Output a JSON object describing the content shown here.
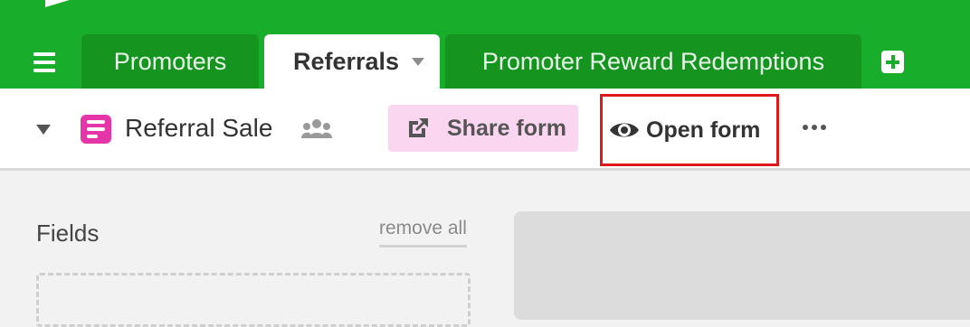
{
  "tabs": [
    {
      "label": "Promoters"
    },
    {
      "label": "Referrals"
    },
    {
      "label": "Promoter Reward Redemptions"
    }
  ],
  "view": {
    "name": "Referral Sale",
    "view_type_icon": "form-icon",
    "collaborators_icon": "people-icon"
  },
  "toolbar": {
    "share_form_label": "Share form",
    "open_form_label": "Open form",
    "more_icon": "ellipsis-icon"
  },
  "fields_panel": {
    "title": "Fields",
    "remove_all_label": "remove all"
  },
  "colors": {
    "brand_green": "#18ad2a",
    "share_button_bg": "#fbd6f1",
    "form_icon_pink": "#e535a8",
    "highlight_red": "#e0181b"
  }
}
